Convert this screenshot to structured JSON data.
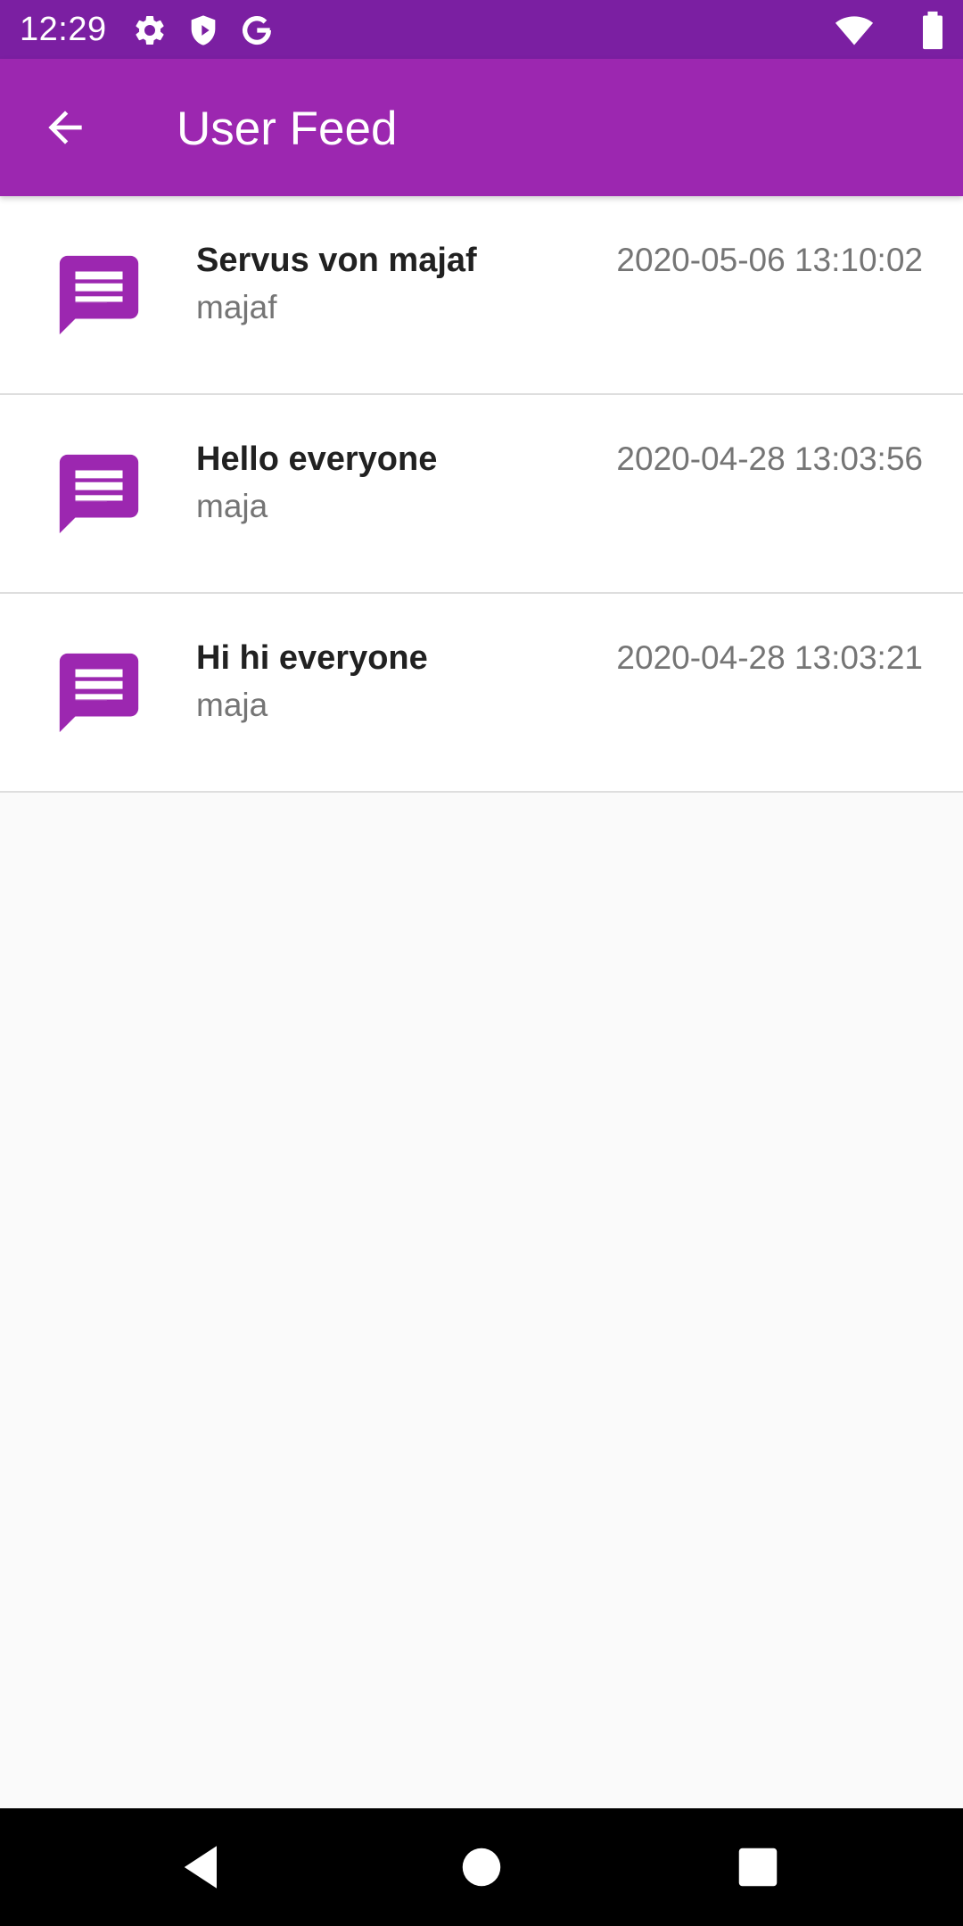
{
  "status_bar": {
    "time": "12:29",
    "icons": [
      "gear-icon",
      "shield-icon",
      "google-icon",
      "wifi-icon",
      "battery-icon"
    ]
  },
  "app_bar": {
    "title": "User Feed",
    "background": "#9c27b0",
    "status_background": "#7b1fa2"
  },
  "feed": {
    "icon": "message-icon",
    "icon_color": "#9c27b0",
    "items": [
      {
        "title": "Servus von majaf",
        "author": "majaf",
        "time": "2020-05-06 13:10:02"
      },
      {
        "title": "Hello everyone",
        "author": "maja",
        "time": "2020-04-28 13:03:56"
      },
      {
        "title": "Hi hi everyone",
        "author": "maja",
        "time": "2020-04-28 13:03:21"
      }
    ]
  },
  "nav_bar": {
    "buttons": [
      "back-triangle-icon",
      "home-circle-icon",
      "recents-square-icon"
    ]
  }
}
